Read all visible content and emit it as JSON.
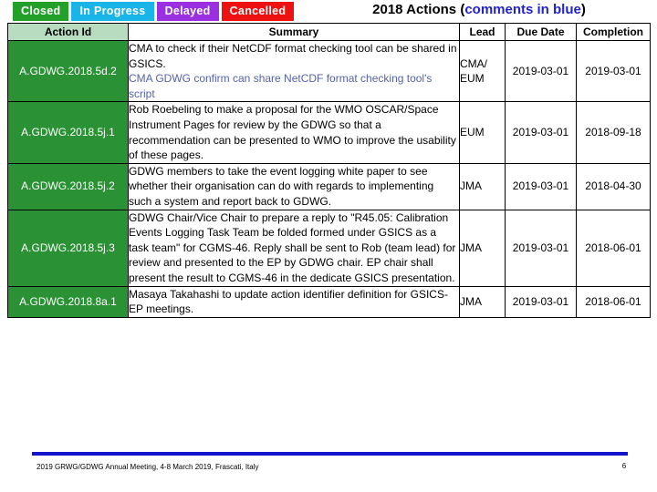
{
  "legend": {
    "tabs": [
      {
        "label": "Closed",
        "color": "#22a02a"
      },
      {
        "label": "In Progress",
        "color": "#19b5e8"
      },
      {
        "label": "Delayed",
        "color": "#9b30e0"
      },
      {
        "label": "Cancelled",
        "color": "#ee1111"
      }
    ]
  },
  "title": {
    "main": "2018 Actions ",
    "paren_open": "(",
    "blue": "comments in blue",
    "paren_close": ")"
  },
  "table": {
    "headers": {
      "action_id": "Action Id",
      "summary": "Summary",
      "lead": "Lead",
      "due_date": "Due Date",
      "completion": "Completion"
    },
    "rows": [
      {
        "action_id": "A.GDWG.2018.5d.2",
        "status_color": "#2a9134",
        "summary": " CMA to check if their NetCDF format checking tool can be shared in GSICS.",
        "comment": "CMA GDWG confirm can share NetCDF format checking tool's script",
        "lead": "CMA/\nEUM",
        "due_date": "2019-03-01",
        "completion": "2019-03-01"
      },
      {
        "action_id": "A.GDWG.2018.5j.1",
        "status_color": "#2a9134",
        "summary": " Rob Roebeling to make a proposal for the WMO OSCAR/Space Instrument Pages for review by the GDWG so that a recommendation can be presented to WMO to improve the usability of these pages.",
        "comment": "",
        "lead": "EUM",
        "due_date": "2019-03-01",
        "completion": "2018-09-18"
      },
      {
        "action_id": "A.GDWG.2018.5j.2",
        "status_color": "#2a9134",
        "summary": " GDWG members to take the event logging white paper to see whether their organisation can do with regards to implementing such a system and report back to GDWG.",
        "comment": "",
        "lead": "JMA",
        "due_date": "2019-03-01",
        "completion": "2018-04-30"
      },
      {
        "action_id": "A.GDWG.2018.5j.3",
        "status_color": "#2a9134",
        "summary": " GDWG Chair/Vice Chair to prepare a reply to \"R45.05: Calibration Events Logging Task Team be folded formed under GSICS as a task team\" for CGMS-46.  Reply shall be sent to Rob (team lead) for review and presented to the EP by GDWG chair.  EP chair shall present the result to CGMS-46 in the dedicate GSICS presentation.",
        "comment": "",
        "lead": "JMA",
        "due_date": "2019-03-01",
        "completion": "2018-06-01"
      },
      {
        "action_id": "A.GDWG.2018.8a.1",
        "status_color": "#2a9134",
        "summary": " Masaya Takahashi to update action identifier definition for GSICS-EP meetings.",
        "comment": "",
        "lead": "JMA",
        "due_date": "2019-03-01",
        "completion": "2018-06-01"
      }
    ]
  },
  "footer": {
    "text": "2019 GRWG/GDWG Annual Meeting, 4-8 March 2019, Frascati, Italy",
    "page_number": "6",
    "rule_color": "#1414cc"
  }
}
